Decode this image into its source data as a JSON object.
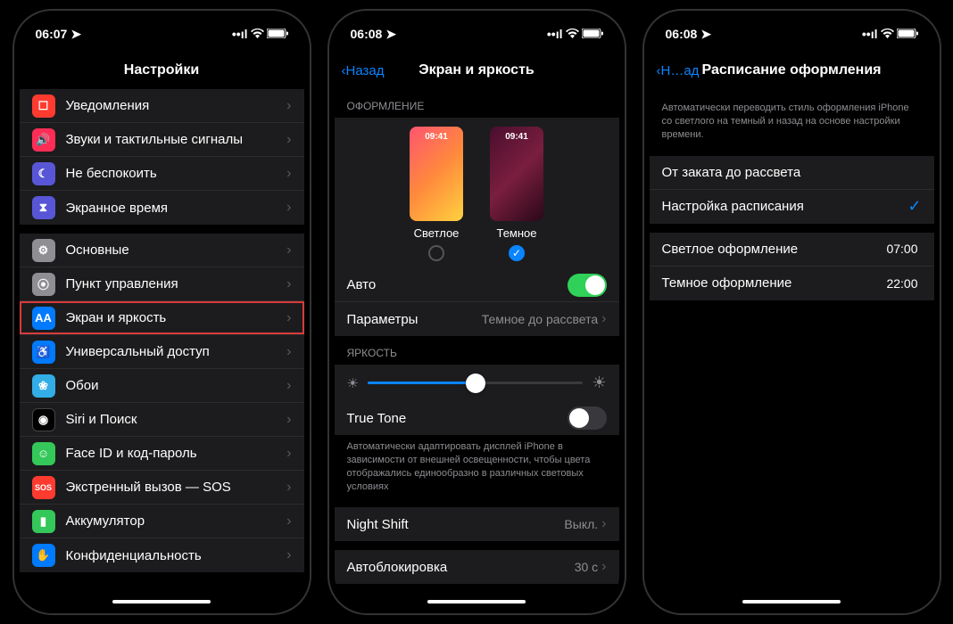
{
  "status": {
    "time1": "06:07",
    "time2": "06:08",
    "time3": "06:08"
  },
  "phone1": {
    "title": "Настройки",
    "group1": [
      {
        "label": "Уведомления",
        "iconClass": "bg-red",
        "glyph": "☐"
      },
      {
        "label": "Звуки и тактильные сигналы",
        "iconClass": "bg-pink",
        "glyph": "🔊"
      },
      {
        "label": "Не беспокоить",
        "iconClass": "bg-purple",
        "glyph": "☾"
      },
      {
        "label": "Экранное время",
        "iconClass": "bg-hourglass",
        "glyph": "⧗"
      }
    ],
    "group2": [
      {
        "label": "Основные",
        "iconClass": "bg-gray",
        "glyph": "⚙"
      },
      {
        "label": "Пункт управления",
        "iconClass": "bg-gray",
        "glyph": "⦿"
      },
      {
        "label": "Экран и яркость",
        "iconClass": "bg-blue",
        "glyph": "AA",
        "highlight": true
      },
      {
        "label": "Универсальный доступ",
        "iconClass": "bg-blue",
        "glyph": "♿"
      },
      {
        "label": "Обои",
        "iconClass": "bg-cyan",
        "glyph": "❀"
      },
      {
        "label": "Siri и Поиск",
        "iconClass": "bg-black",
        "glyph": "◉"
      },
      {
        "label": "Face ID и код-пароль",
        "iconClass": "bg-green",
        "glyph": "☺"
      },
      {
        "label": "Экстренный вызов — SOS",
        "iconClass": "bg-sos",
        "glyph": "SOS"
      },
      {
        "label": "Аккумулятор",
        "iconClass": "bg-green",
        "glyph": "▮"
      },
      {
        "label": "Конфиденциальность",
        "iconClass": "bg-blue",
        "glyph": "✋"
      }
    ]
  },
  "phone2": {
    "back": "Назад",
    "title": "Экран и яркость",
    "sec_appearance": "ОФОРМЛЕНИЕ",
    "light": "Светлое",
    "dark": "Темное",
    "preview_time": "09:41",
    "auto": "Авто",
    "params": "Параметры",
    "params_value": "Темное до рассвета",
    "sec_brightness": "ЯРКОСТЬ",
    "truetone": "True Tone",
    "truetone_desc": "Автоматически адаптировать дисплей iPhone в зависимости от внешней освещенности, чтобы цвета отображались единообразно в различных световых условиях",
    "nightshift": "Night Shift",
    "nightshift_value": "Выкл.",
    "autolock": "Автоблокировка",
    "autolock_value": "30 с"
  },
  "phone3": {
    "back": "Н…ад",
    "title": "Расписание оформления",
    "desc": "Автоматически переводить стиль оформления iPhone со светлого на темный и назад на основе настройки времени.",
    "opt1": "От заката до рассвета",
    "opt2": "Настройка расписания",
    "light_row": "Светлое оформление",
    "light_time": "07:00",
    "dark_row": "Темное оформление",
    "dark_time": "22:00"
  }
}
